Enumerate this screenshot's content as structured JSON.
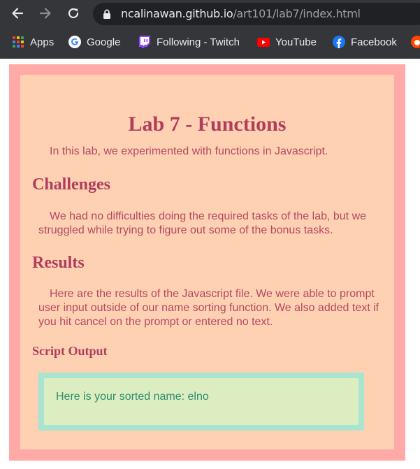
{
  "browser": {
    "url_host": "ncalinawan.github.io",
    "url_path": "/art101/lab7/index.html",
    "bookmarks": [
      {
        "label": "Apps",
        "icon": "apps-grid-icon"
      },
      {
        "label": "Google",
        "icon": "google-icon"
      },
      {
        "label": "Following - Twitch",
        "icon": "twitch-icon"
      },
      {
        "label": "YouTube",
        "icon": "youtube-icon"
      },
      {
        "label": "Facebook",
        "icon": "facebook-icon"
      }
    ]
  },
  "page": {
    "title": "Lab 7 - Functions",
    "intro": "In this lab, we experimented with functions in Javascript.",
    "challenges_heading": "Challenges",
    "challenges_text": "We had no difficulties doing the required tasks of the lab, but we struggled while trying to figure out some of the bonus tasks.",
    "results_heading": "Results",
    "results_text": "Here are the results of the Javascript file. We were able to prompt user input outside of our name sorting function. We also added text if you hit cancel on the prompt or entered no text.",
    "output_heading": "Script Output",
    "output_text": "Here is your sorted name: elno"
  },
  "colors": {
    "chrome_bg": "#35363a",
    "page_border": "#ffaaa6",
    "card_bg": "#fed1b3",
    "heading": "#b03d5c",
    "body_text": "#b54a62",
    "output_border": "#a9e4d0",
    "output_bg": "#dcedc1",
    "output_text": "#2e8d6a"
  }
}
